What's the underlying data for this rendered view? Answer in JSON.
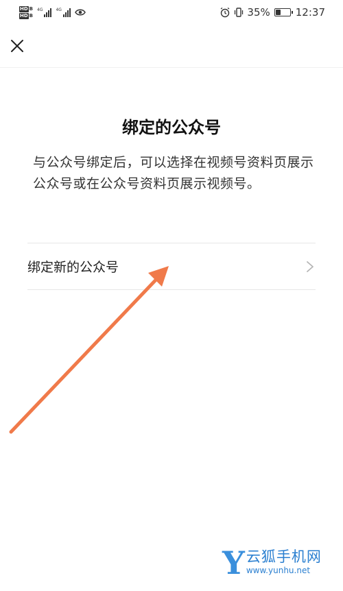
{
  "status_bar": {
    "hd_badge": "HD",
    "hd_sub": "B",
    "network_label": "4G",
    "battery_text": "35%",
    "battery_level": 0.35,
    "time": "12:37"
  },
  "page": {
    "title": "绑定的公众号",
    "description": "与公众号绑定后，可以选择在视频号资料页展示公众号或在公众号资料页展示视频号。"
  },
  "bind_row": {
    "label": "绑定新的公众号"
  },
  "icons": {
    "close": "close-icon",
    "chevron": "chevron-right-icon",
    "alarm": "alarm-icon",
    "vibrate": "vibrate-icon",
    "eye": "eye-icon",
    "battery": "battery-icon"
  },
  "colors": {
    "annotation_arrow": "#f07a4a",
    "watermark": "#2a7fd0"
  },
  "watermark": {
    "logo": "Y",
    "name": "云狐手机网",
    "url": "www.yunhu.net"
  }
}
